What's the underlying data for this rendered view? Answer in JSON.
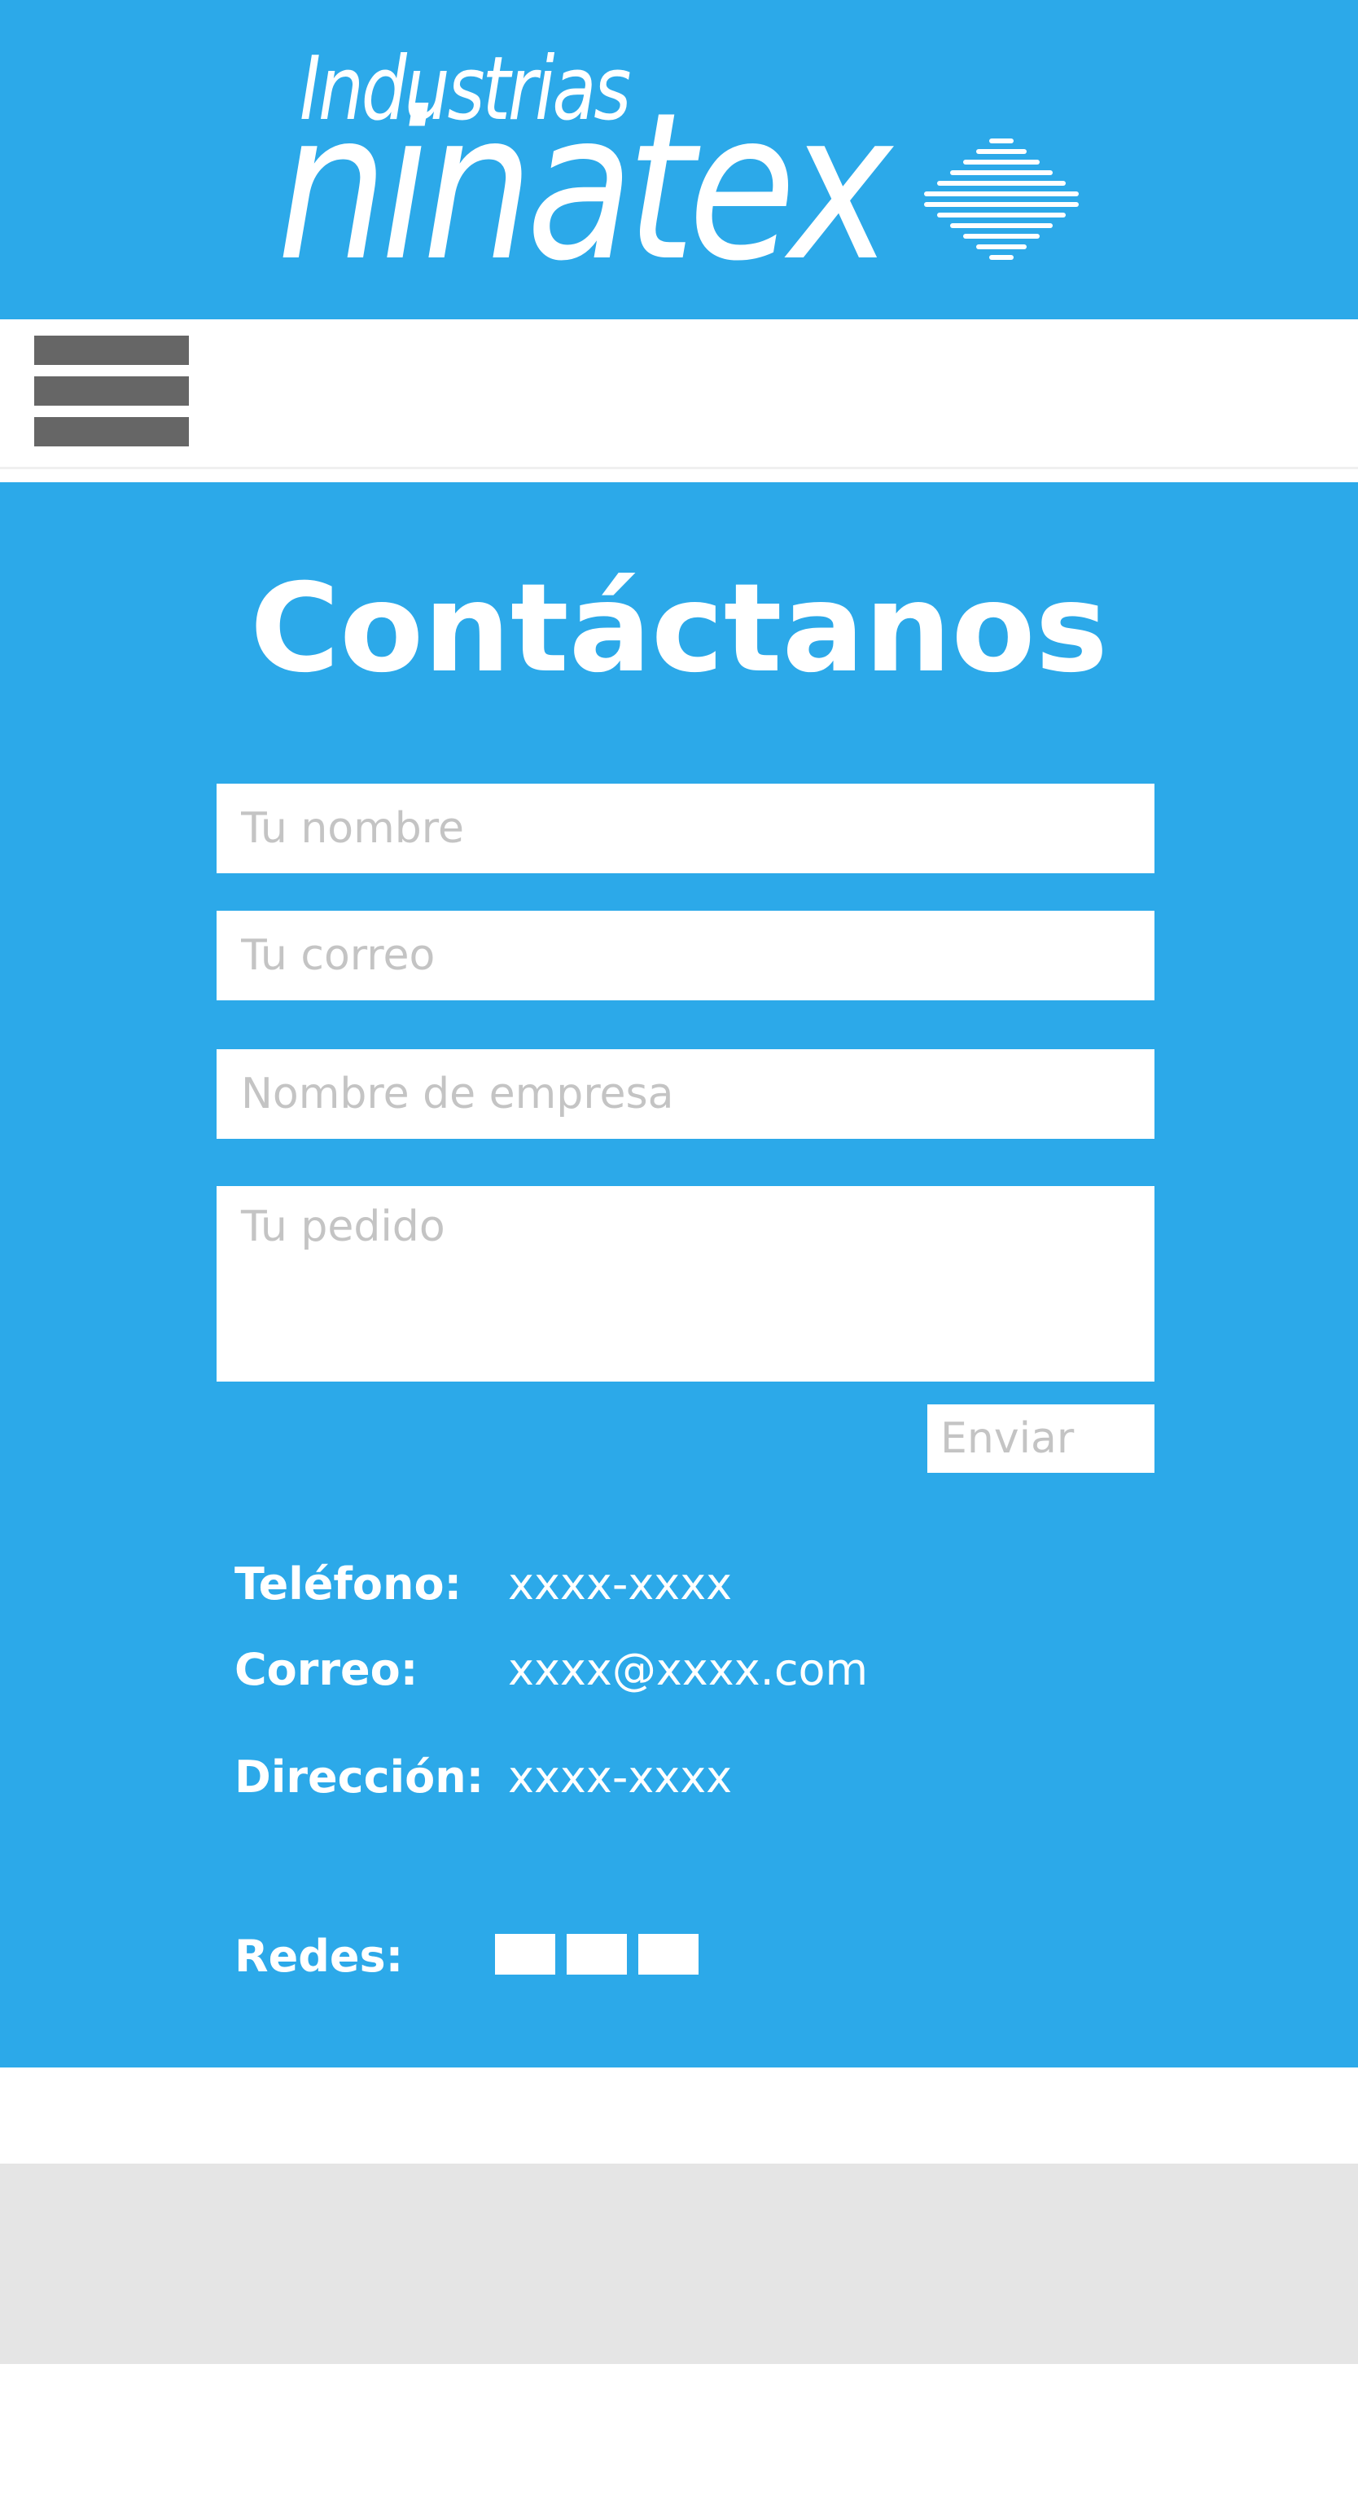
{
  "brand": {
    "top_word": "Industrias",
    "main_word": "ninatex",
    "primary_color": "#2ca9e9"
  },
  "nav": {
    "menu_icon": "hamburger-menu-icon"
  },
  "contact": {
    "title": "Contáctanos",
    "form": {
      "name_placeholder": "Tu nombre",
      "email_placeholder": "Tu correo",
      "company_placeholder": "Nombre de empresa",
      "order_placeholder": "Tu pedido",
      "submit_label": "Enviar"
    },
    "info": {
      "phone_label": "Teléfono:",
      "phone_value": "xxxx-xxxx",
      "email_label": "Correo:",
      "email_value": "xxxx@xxxx.com",
      "address_label": "Dirección:",
      "address_value": "xxxx-xxxx",
      "social_label": "Redes:",
      "social_icons": [
        "social-icon-1",
        "social-icon-2",
        "social-icon-3"
      ]
    }
  }
}
